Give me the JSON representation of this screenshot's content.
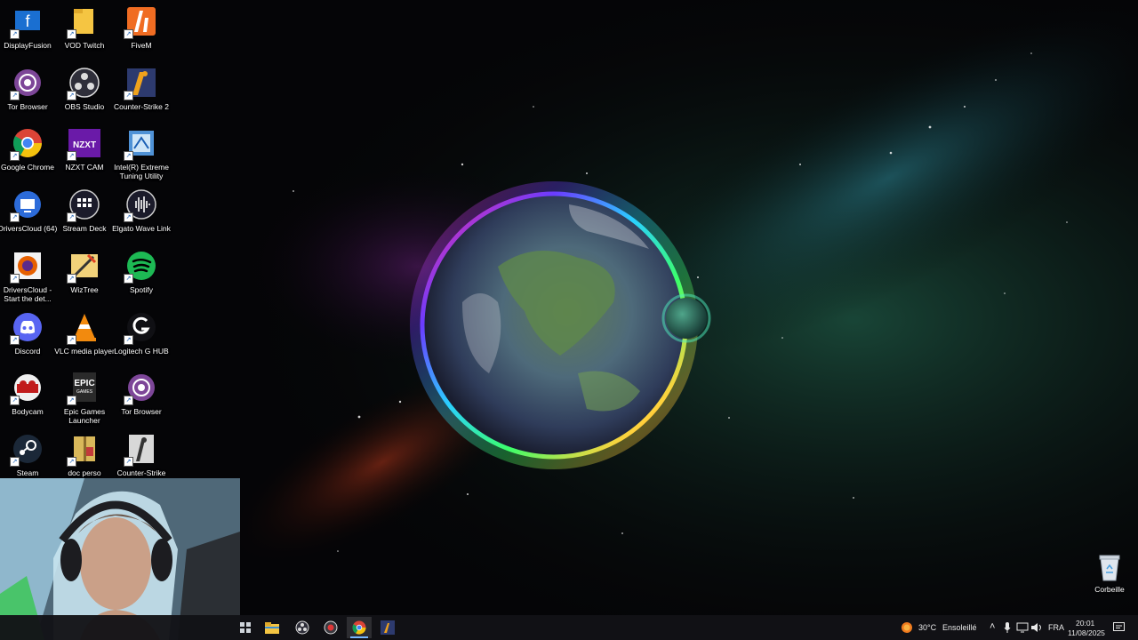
{
  "desktop": {
    "icons": [
      {
        "label": "DisplayFusion",
        "icon": "displayfusion-icon"
      },
      {
        "label": "VOD Twitch",
        "icon": "folder-icon"
      },
      {
        "label": "FiveM",
        "icon": "fivem-icon"
      },
      {
        "label": "Tor Browser",
        "icon": "tor-browser-icon"
      },
      {
        "label": "OBS Studio",
        "icon": "obs-studio-icon"
      },
      {
        "label": "Counter-Strike 2",
        "icon": "counter-strike-2-icon"
      },
      {
        "label": "Google Chrome",
        "icon": "chrome-icon"
      },
      {
        "label": "NZXT CAM",
        "icon": "nzxt-cam-icon"
      },
      {
        "label": "Intel(R) Extreme Tuning Utility",
        "icon": "intel-xtu-icon"
      },
      {
        "label": "DriversCloud (64)",
        "icon": "driverscloud-icon"
      },
      {
        "label": "Stream Deck",
        "icon": "stream-deck-icon"
      },
      {
        "label": "Elgato Wave Link",
        "icon": "wave-link-icon"
      },
      {
        "label": "DriversCloud - Start the det...",
        "icon": "firefox-icon"
      },
      {
        "label": "WizTree",
        "icon": "wiztree-icon"
      },
      {
        "label": "Spotify",
        "icon": "spotify-icon"
      },
      {
        "label": "Discord",
        "icon": "discord-icon"
      },
      {
        "label": "VLC media player",
        "icon": "vlc-icon"
      },
      {
        "label": "Logitech G HUB",
        "icon": "logitech-ghub-icon"
      },
      {
        "label": "Bodycam",
        "icon": "bodycam-icon"
      },
      {
        "label": "Epic Games Launcher",
        "icon": "epic-games-icon"
      },
      {
        "label": "Tor Browser",
        "icon": "tor-browser-icon"
      },
      {
        "label": "Steam",
        "icon": "steam-icon"
      },
      {
        "label": "doc perso",
        "icon": "folder-zip-icon"
      },
      {
        "label": "Counter-Strike",
        "icon": "counter-strike-icon"
      }
    ],
    "recycle_bin_label": "Corbeille",
    "icon_badges": {
      "nzxt": "NZXT",
      "epic": "EPIC",
      "epic_sub": "GAMES"
    }
  },
  "taskbar": {
    "apps": [
      "file-explorer-icon",
      "obs-studio-icon",
      "rec-icon",
      "chrome-icon",
      "counter-strike-2-icon"
    ],
    "weather": {
      "temperature": "30°C",
      "condition": "Ensoleillé"
    },
    "language": "FRA",
    "time": "20:01",
    "date": "11/08/2025"
  },
  "colors": {
    "taskbar": "#121216",
    "accent": "#77b7ff"
  }
}
